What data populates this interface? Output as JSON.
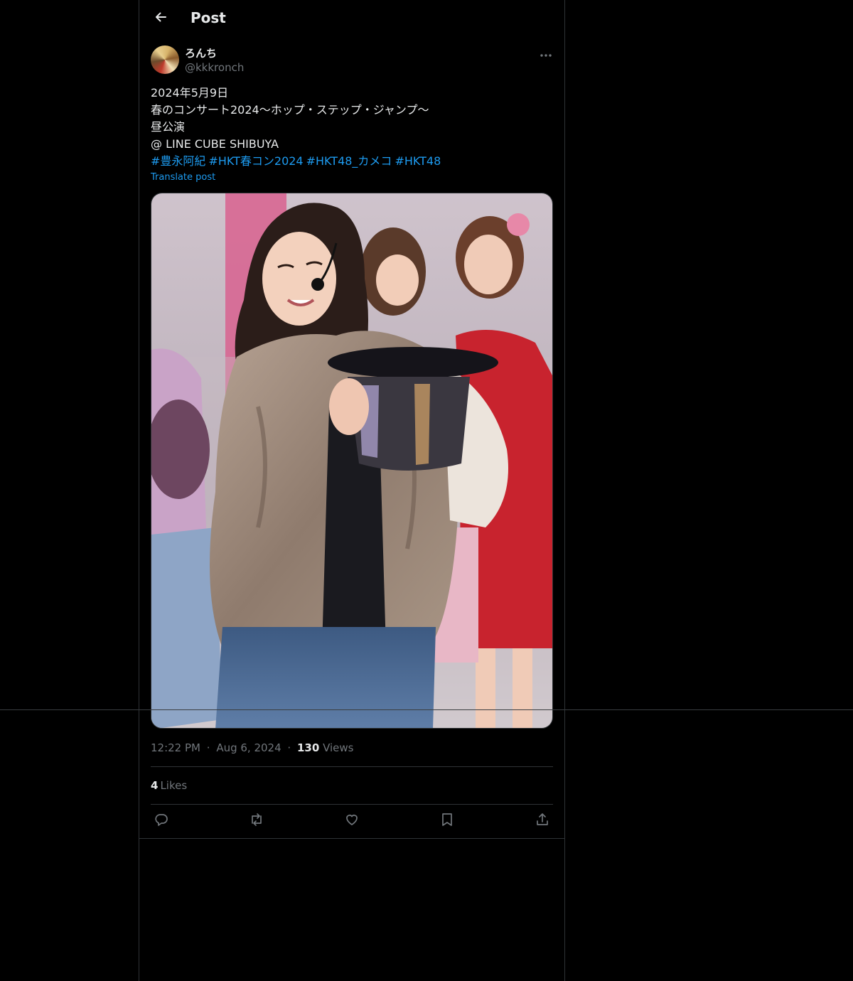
{
  "header": {
    "title": "Post",
    "back_icon": "arrow-left-icon"
  },
  "author": {
    "name": "ろんち",
    "handle": "@kkkronch"
  },
  "post": {
    "lines": [
      "2024年5月9日",
      "春のコンサート2024〜ホップ・ステップ・ジャンプ〜",
      "昼公演",
      "@ LINE CUBE SHIBUYA"
    ],
    "hashtags": [
      "#豊永阿紀",
      "#HKT春コン2024",
      "#HKT48_カメコ",
      "#HKT48"
    ],
    "translate_label": "Translate post"
  },
  "meta": {
    "time": "12:22 PM",
    "sep": "·",
    "date": "Aug 6, 2024",
    "views_count": "130",
    "views_label": "Views"
  },
  "engagement": {
    "likes_count": "4",
    "likes_label": "Likes"
  },
  "actions": [
    "reply-icon",
    "repost-icon",
    "like-icon",
    "bookmark-icon",
    "share-icon"
  ],
  "colors": {
    "background": "#000000",
    "text": "#e7e9ea",
    "muted": "#71767b",
    "link": "#1d9bf0",
    "border": "#2f3336"
  }
}
